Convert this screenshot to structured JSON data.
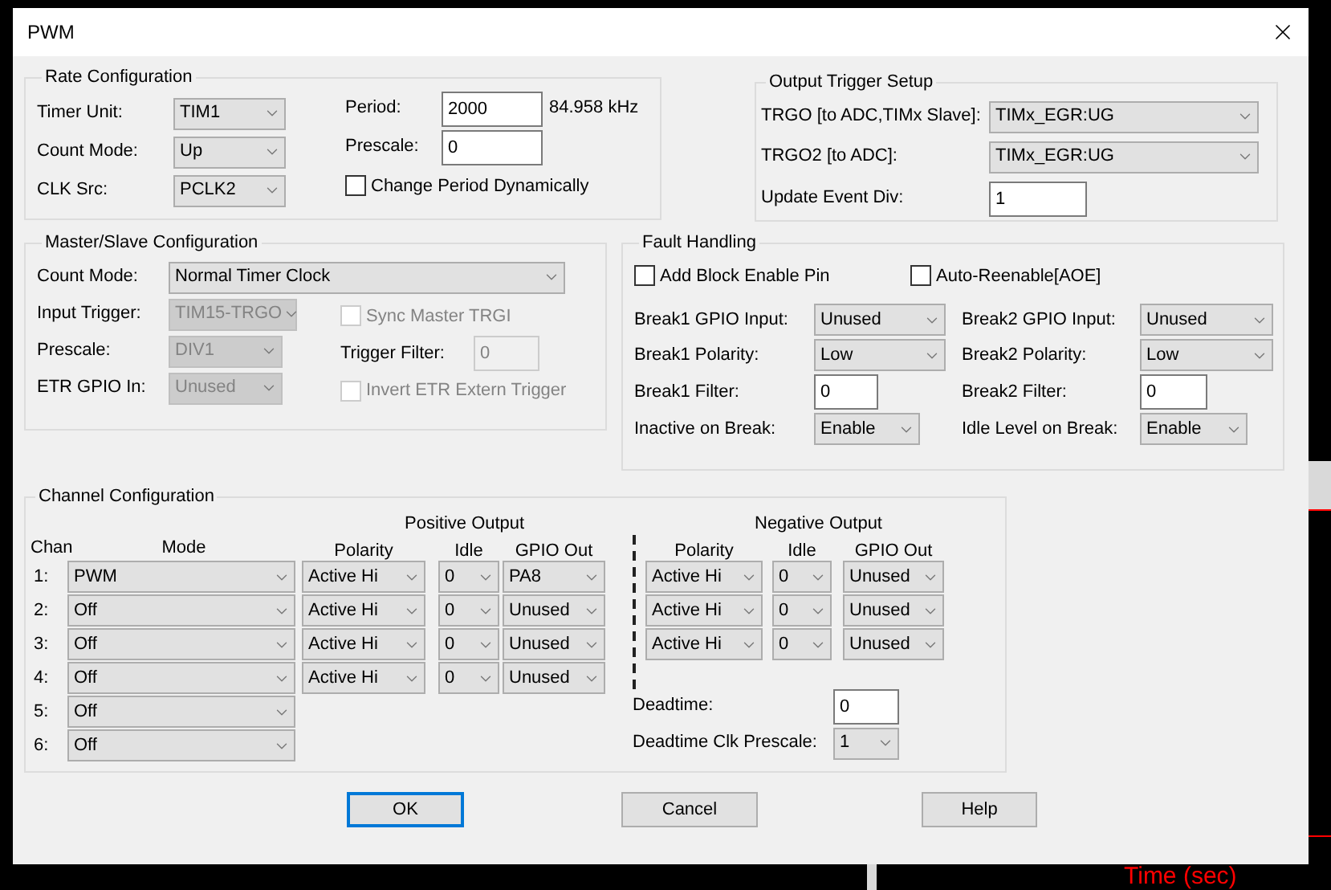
{
  "window": {
    "title": "PWM"
  },
  "rate": {
    "title": "Rate Configuration",
    "timer_unit": {
      "label": "Timer Unit:",
      "value": "TIM1"
    },
    "count_mode": {
      "label": "Count Mode:",
      "value": "Up"
    },
    "clk_src": {
      "label": "CLK Src:",
      "value": "PCLK2"
    },
    "period": {
      "label": "Period:",
      "value": "2000"
    },
    "frequency": "84.958 kHz",
    "prescale": {
      "label": "Prescale:",
      "value": "0"
    },
    "change_period": {
      "label": "Change Period Dynamically",
      "checked": false
    }
  },
  "output_trigger": {
    "title": "Output Trigger Setup",
    "trgo": {
      "label": "TRGO [to ADC,TIMx Slave]:",
      "value": "TIMx_EGR:UG"
    },
    "trgo2": {
      "label": "TRGO2 [to ADC]:",
      "value": "TIMx_EGR:UG"
    },
    "update_event_div": {
      "label": "Update Event Div:",
      "value": "1"
    }
  },
  "master_slave": {
    "title": "Master/Slave Configuration",
    "count_mode": {
      "label": "Count Mode:",
      "value": "Normal Timer Clock",
      "disabled": false
    },
    "input_trigger": {
      "label": "Input Trigger:",
      "value": "TIM15-TRGO",
      "disabled": true
    },
    "prescale": {
      "label": "Prescale:",
      "value": "DIV1",
      "disabled": true
    },
    "etr_gpio_in": {
      "label": "ETR GPIO In:",
      "value": "Unused",
      "disabled": true
    },
    "sync_master": {
      "label": "Sync Master TRGI",
      "checked": false,
      "disabled": true
    },
    "trigger_filter": {
      "label": "Trigger Filter:",
      "value": "0",
      "disabled": true
    },
    "invert_etr": {
      "label": "Invert ETR Extern Trigger",
      "checked": false,
      "disabled": true
    }
  },
  "fault": {
    "title": "Fault Handling",
    "add_block_enable": {
      "label": "Add Block Enable Pin",
      "checked": false
    },
    "auto_reenable": {
      "label": "Auto-Reenable[AOE]",
      "checked": false
    },
    "break1_gpio": {
      "label": "Break1 GPIO Input:",
      "value": "Unused"
    },
    "break1_polarity": {
      "label": "Break1 Polarity:",
      "value": "Low"
    },
    "break1_filter": {
      "label": "Break1 Filter:",
      "value": "0"
    },
    "inactive_on_break": {
      "label": "Inactive on Break:",
      "value": "Enable"
    },
    "break2_gpio": {
      "label": "Break2 GPIO Input:",
      "value": "Unused"
    },
    "break2_polarity": {
      "label": "Break2 Polarity:",
      "value": "Low"
    },
    "break2_filter": {
      "label": "Break2 Filter:",
      "value": "0"
    },
    "idle_level_on_break": {
      "label": "Idle Level on Break:",
      "value": "Enable"
    }
  },
  "channels": {
    "title": "Channel Configuration",
    "positive_heading": "Positive Output",
    "negative_heading": "Negative Output",
    "columns": {
      "chan": "Chan",
      "mode": "Mode",
      "polarity": "Polarity",
      "idle": "Idle",
      "gpio_out": "GPIO Out",
      "neg_polarity": "Polarity",
      "neg_idle": "Idle",
      "neg_gpio_out": "GPIO Out"
    },
    "rows": [
      {
        "number": "1:",
        "mode": "PWM",
        "positive": {
          "polarity": "Active Hi",
          "idle": "0",
          "gpio_out": "PA8"
        },
        "negative": {
          "polarity": "Active Hi",
          "idle": "0",
          "gpio_out": "Unused"
        }
      },
      {
        "number": "2:",
        "mode": "Off",
        "positive": {
          "polarity": "Active Hi",
          "idle": "0",
          "gpio_out": "Unused"
        },
        "negative": {
          "polarity": "Active Hi",
          "idle": "0",
          "gpio_out": "Unused"
        }
      },
      {
        "number": "3:",
        "mode": "Off",
        "positive": {
          "polarity": "Active Hi",
          "idle": "0",
          "gpio_out": "Unused"
        },
        "negative": {
          "polarity": "Active Hi",
          "idle": "0",
          "gpio_out": "Unused"
        }
      },
      {
        "number": "4:",
        "mode": "Off",
        "positive": {
          "polarity": "Active Hi",
          "idle": "0",
          "gpio_out": "Unused"
        }
      },
      {
        "number": "5:",
        "mode": "Off"
      },
      {
        "number": "6:",
        "mode": "Off"
      }
    ],
    "deadtime": {
      "label": "Deadtime:",
      "value": "0"
    },
    "deadtime_prescale": {
      "label": "Deadtime Clk Prescale:",
      "value": "1"
    }
  },
  "buttons": [
    {
      "label": "OK",
      "focused": true
    },
    {
      "label": "Cancel",
      "focused": false
    },
    {
      "label": "Help",
      "focused": false
    }
  ],
  "background": {
    "axis_label": "Time (sec)"
  }
}
